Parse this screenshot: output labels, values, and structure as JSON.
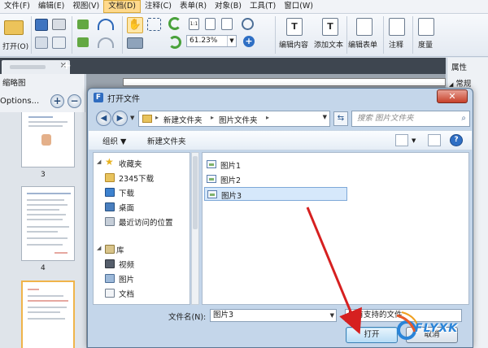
{
  "menu": [
    "文件(F)",
    "编辑(E)",
    "视图(V)",
    "文档(D)",
    "注释(C)",
    "表单(R)",
    "对象(B)",
    "工具(T)",
    "窗口(W)"
  ],
  "menu_active_index": 3,
  "toolbar": {
    "open_label": "打开(O)",
    "zoom_value": "61.23%",
    "edit_content": "编辑内容",
    "add_text": "添加文本",
    "edit_form": "编辑表单",
    "annotate": "注释",
    "measure": "度量"
  },
  "left_panel": {
    "title": "缩略图",
    "options": "Options...",
    "page_numbers": [
      "3",
      "4"
    ]
  },
  "right_panel": {
    "title": "属性",
    "group": "常规"
  },
  "dialog": {
    "title": "打开文件",
    "address": [
      "新建文件夹",
      "图片文件夹"
    ],
    "search_placeholder": "搜索 图片文件夹",
    "commands": [
      "组织",
      "新建文件夹"
    ],
    "nav_items": [
      {
        "label": "收藏夹",
        "icon": "star-icon"
      },
      {
        "label": "2345下载",
        "icon": "folder-icon"
      },
      {
        "label": "下载",
        "icon": "download-folder-icon"
      },
      {
        "label": "桌面",
        "icon": "desktop-icon"
      },
      {
        "label": "最近访问的位置",
        "icon": "recent-places-icon"
      },
      {
        "label": "库",
        "icon": "library-icon"
      },
      {
        "label": "视频",
        "icon": "video-library-icon"
      },
      {
        "label": "图片",
        "icon": "picture-library-icon"
      },
      {
        "label": "文档",
        "icon": "document-library-icon"
      }
    ],
    "files": [
      "图片1",
      "图片2",
      "图片3"
    ],
    "selected_file_index": 2,
    "filename_label": "文件名(N):",
    "filename_value": "图片3",
    "filter_value": "所有支持的文件",
    "open_button": "打开",
    "cancel_button": "取消"
  },
  "colors": {
    "arrow": "#d62020",
    "accent": "#2a84d8"
  }
}
